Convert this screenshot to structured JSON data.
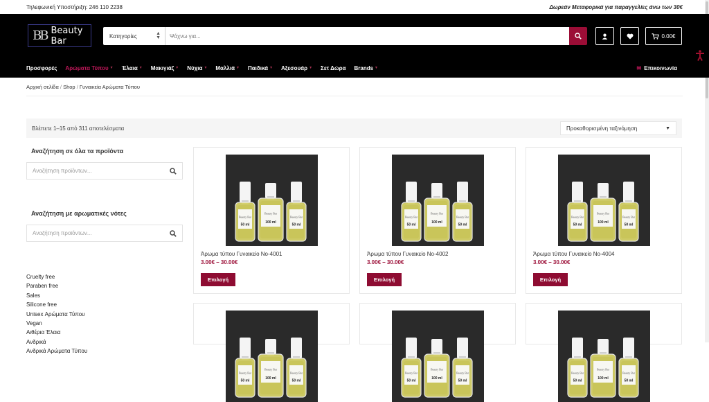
{
  "topbar": {
    "phone": "Τηλεφωνική Υποστήριξη: 246 110 2238",
    "free_shipping": "Δωρεάν Μεταφορικά για παραγγελίες άνω των 30€"
  },
  "header": {
    "logo_text": "Beauty Bar",
    "categories_label": "Κατηγορίες",
    "search_placeholder": "Ψάχνω για...",
    "cart_total": "0.00€",
    "cart_count": "0"
  },
  "nav": {
    "items": [
      {
        "label": "Προσφορές",
        "dropdown": false
      },
      {
        "label": "Αρώματα Τύπου",
        "dropdown": true,
        "active": true
      },
      {
        "label": "Έλαια",
        "dropdown": true
      },
      {
        "label": "Μακιγιάζ",
        "dropdown": true
      },
      {
        "label": "Νύχια",
        "dropdown": true
      },
      {
        "label": "Μαλλιά",
        "dropdown": true
      },
      {
        "label": "Παιδικά",
        "dropdown": true
      },
      {
        "label": "Αξεσουάρ",
        "dropdown": true
      },
      {
        "label": "Σετ Δώρα",
        "dropdown": false
      },
      {
        "label": "Brands",
        "dropdown": true
      }
    ],
    "contact": "Επικοινωνία"
  },
  "breadcrumb": {
    "home": "Αρχική σελίδα",
    "shop": "Shop",
    "current": "Γυναικεία Αρώματα Τύπου"
  },
  "results": {
    "count_text": "Βλέπετε 1–15 από 311 αποτελέσματα",
    "sort_selected": "Προκαθορισμένη ταξινόμηση"
  },
  "sidebar": {
    "widget1_title": "Αναζήτηση σε όλα τα προϊόντα",
    "widget1_placeholder": "Αναζήτηση προϊόντων...",
    "widget2_title": "Αναζήτηση με αρωματικές νότες",
    "widget2_placeholder": "Αναζήτηση προϊόντων...",
    "tags": [
      "Cruelty free",
      "Paraben free",
      "Sales",
      "Silicone free",
      "Unisex Αρώματα Τύπου",
      "Vegan",
      "Αιθέρια Έλαια",
      "Ανδρικά",
      "Ανδρικά Αρώματα Τύπου"
    ]
  },
  "products": [
    {
      "title": "Άρωμα τύπου Γυναικείο No-4001",
      "price": "3.00€ – 30.00€",
      "button": "Επιλογή"
    },
    {
      "title": "Άρωμα τύπου Γυναικείο No-4002",
      "price": "3.00€ – 30.00€",
      "button": "Επιλογή"
    },
    {
      "title": "Άρωμα τύπου Γυναικείο No-4004",
      "price": "3.00€ – 30.00€",
      "button": "Επιλογή"
    },
    {
      "title": "",
      "price": "",
      "button": ""
    },
    {
      "title": "",
      "price": "",
      "button": ""
    },
    {
      "title": "",
      "price": "",
      "button": ""
    }
  ],
  "bottle_labels": {
    "brand": "Beauty Bar",
    "small": "50 ml",
    "large": "100 ml"
  },
  "colors": {
    "accent": "#9b0d36",
    "header_bg": "#000000",
    "nav_active": "#c2185b"
  },
  "icons": [
    "search-icon",
    "user-icon",
    "heart-icon",
    "cart-icon",
    "accessibility-icon"
  ]
}
